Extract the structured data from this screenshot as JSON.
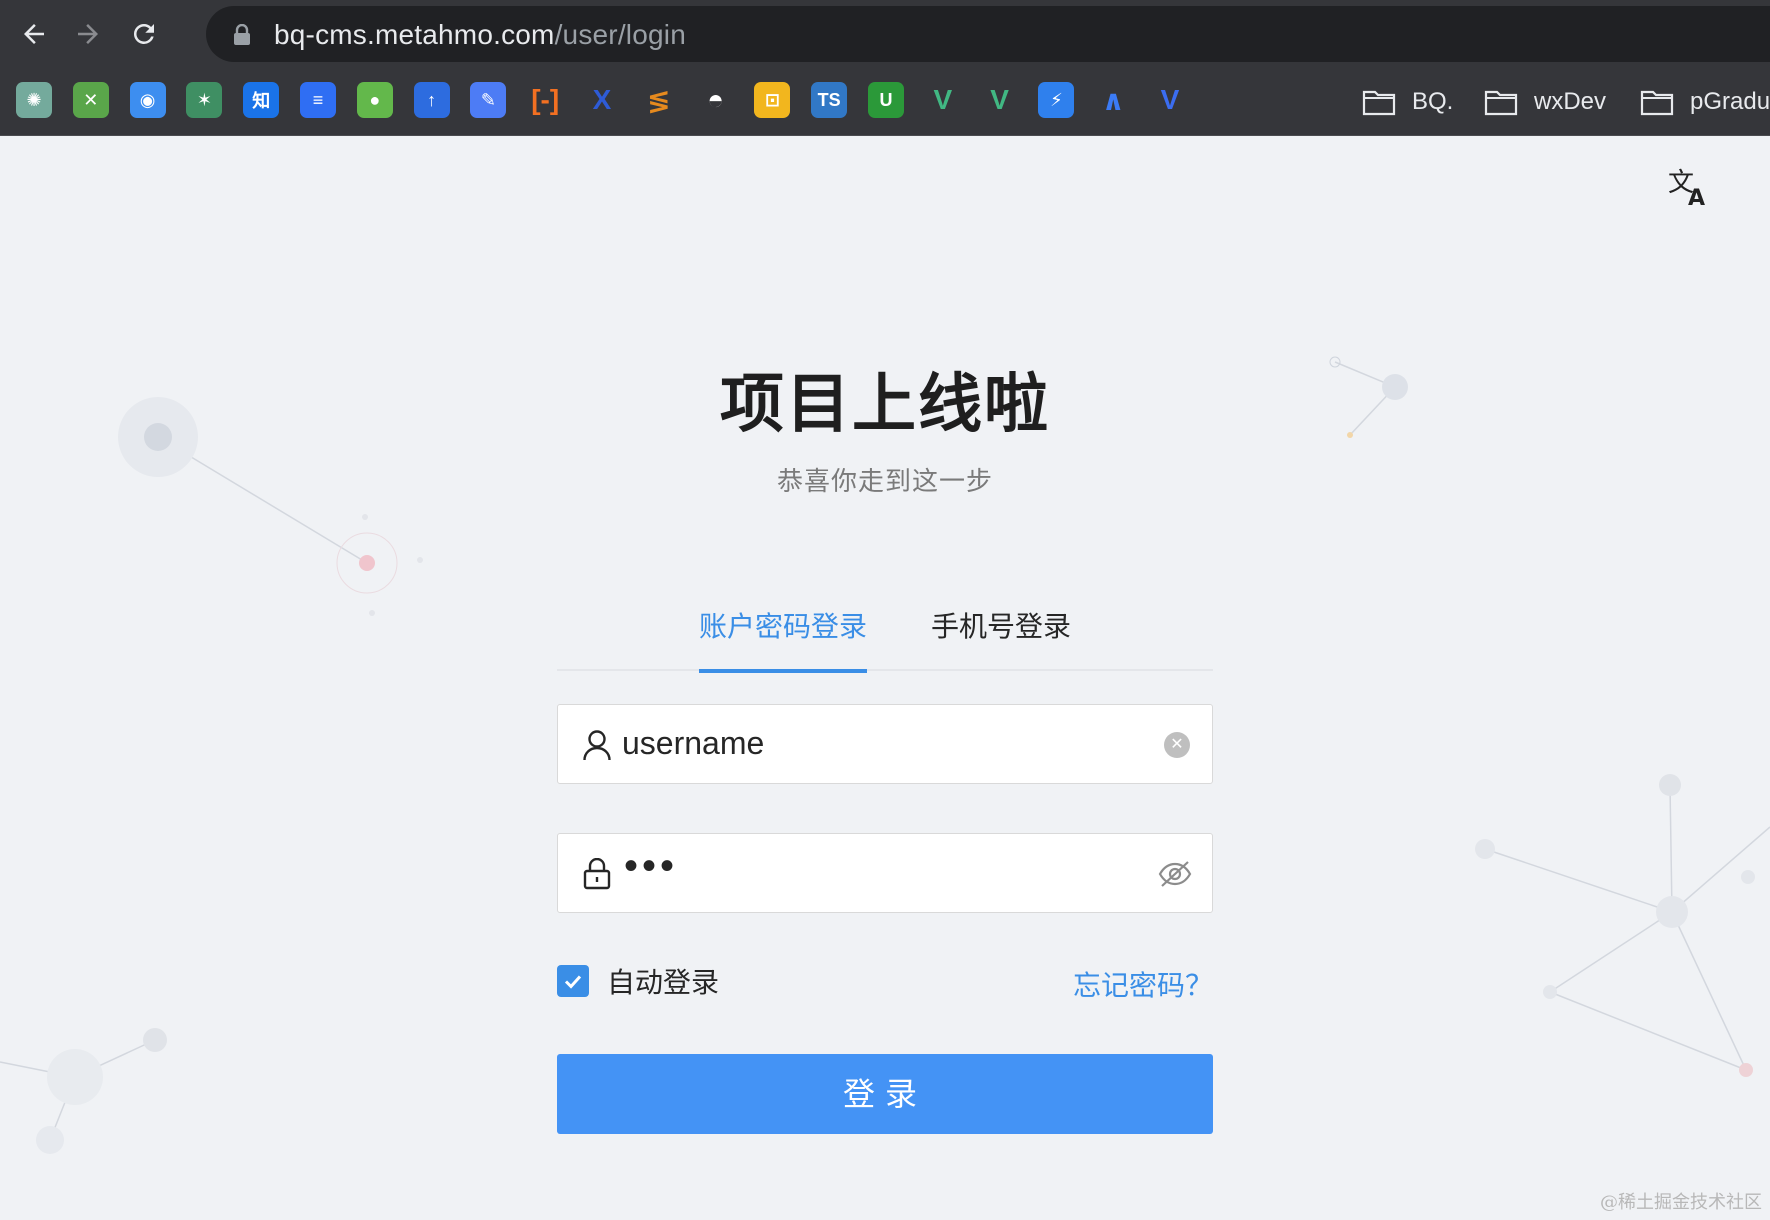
{
  "browser": {
    "url_host": "bq-cms.metahmo.com",
    "url_path": "/user/login",
    "bookmarks": [
      {
        "icon": "chatgpt-icon",
        "color": "#74aa9c",
        "glyph": "✺"
      },
      {
        "icon": "tools-icon",
        "color": "#5aa64a",
        "glyph": "✕"
      },
      {
        "icon": "finder-icon",
        "color": "#3d8ef0",
        "glyph": "◉"
      },
      {
        "icon": "fan-icon",
        "color": "#3f8f63",
        "glyph": "✶"
      },
      {
        "icon": "zhihu-icon",
        "color": "#1a73e8",
        "glyph": "知"
      },
      {
        "icon": "docs-icon",
        "color": "#2f6ef3",
        "glyph": "≡"
      },
      {
        "icon": "green-circle-icon",
        "color": "#63b84b",
        "glyph": "●"
      },
      {
        "icon": "arrow-logo-icon",
        "color": "#2d6cdf",
        "glyph": "↑"
      },
      {
        "icon": "edit-icon",
        "color": "#4d7cf5",
        "glyph": "✎"
      },
      {
        "icon": "alibaba-icon",
        "color": "#f27022",
        "glyph": "[-]"
      },
      {
        "icon": "x-logo-icon",
        "color": "#2e5bd6",
        "glyph": "X"
      },
      {
        "icon": "stack-icon",
        "color": "#e68a1e",
        "glyph": "≶"
      },
      {
        "icon": "github-icon",
        "color": "#ffffff",
        "glyph": "◓"
      },
      {
        "icon": "figma-like-icon",
        "color": "#f2b61e",
        "glyph": "⊡"
      },
      {
        "icon": "typescript-icon",
        "color": "#3178c6",
        "glyph": "TS"
      },
      {
        "icon": "uni-icon",
        "color": "#2b9939",
        "glyph": "U"
      },
      {
        "icon": "vue-icon",
        "color": "#41b883",
        "glyph": "V"
      },
      {
        "icon": "vue-alt-icon",
        "color": "#41b883",
        "glyph": "V"
      },
      {
        "icon": "bolt-icon",
        "color": "#2f80ed",
        "glyph": "⚡"
      },
      {
        "icon": "arc-icon",
        "color": "#3b7bf6",
        "glyph": "∧"
      },
      {
        "icon": "vitest-icon",
        "color": "#3b6df0",
        "glyph": "V"
      }
    ],
    "folders": [
      "BQ.",
      "wxDev",
      "pGradu"
    ]
  },
  "page": {
    "title": "项目上线啦",
    "subtitle": "恭喜你走到这一步",
    "tabs": [
      {
        "label": "账户密码登录",
        "active": true
      },
      {
        "label": "手机号登录",
        "active": false
      }
    ],
    "username_value": "username",
    "password_mask": "•••",
    "remember_label": "自动登录",
    "remember_checked": true,
    "forgot_label": "忘记密码？",
    "login_label": "登录",
    "watermark": "@稀土掘金技术社区"
  },
  "colors": {
    "accent": "#3a8ee6",
    "button": "#4493f5",
    "background": "#f0f2f5"
  }
}
